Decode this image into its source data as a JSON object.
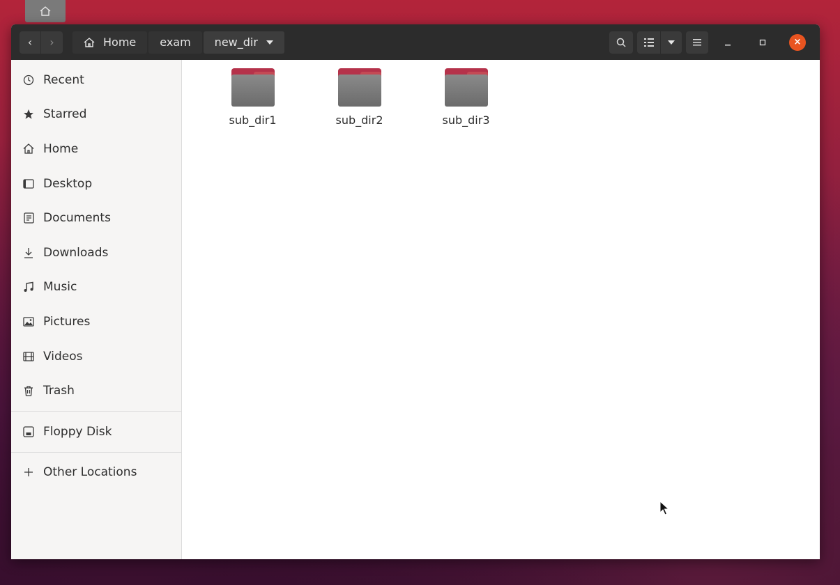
{
  "window": {
    "nav": {
      "back": "‹",
      "forward": "›"
    },
    "path": [
      {
        "label": "Home",
        "icon": "home-icon"
      },
      {
        "label": "exam"
      },
      {
        "label": "new_dir",
        "current": true
      }
    ],
    "toolbar": {
      "search": "search-icon",
      "view": "list-view-icon",
      "menu": "hamburger-menu-icon"
    },
    "controls": {
      "minimize": "–",
      "maximize": "▫",
      "close": "×"
    }
  },
  "sidebar": {
    "items": [
      {
        "label": "Recent",
        "icon": "clock-icon"
      },
      {
        "label": "Starred",
        "icon": "star-icon"
      },
      {
        "label": "Home",
        "icon": "home-icon"
      },
      {
        "label": "Desktop",
        "icon": "desktop-icon"
      },
      {
        "label": "Documents",
        "icon": "documents-icon"
      },
      {
        "label": "Downloads",
        "icon": "download-icon"
      },
      {
        "label": "Music",
        "icon": "music-icon"
      },
      {
        "label": "Pictures",
        "icon": "pictures-icon"
      },
      {
        "label": "Videos",
        "icon": "videos-icon"
      },
      {
        "label": "Trash",
        "icon": "trash-icon"
      }
    ],
    "devices": [
      {
        "label": "Floppy Disk",
        "icon": "floppy-disk-icon"
      }
    ],
    "other": {
      "label": "Other Locations",
      "icon": "plus-icon"
    }
  },
  "files": [
    {
      "name": "sub_dir1"
    },
    {
      "name": "sub_dir2"
    },
    {
      "name": "sub_dir3"
    }
  ],
  "colors": {
    "accent": "#e95420",
    "folder_tab": "#b5324a"
  }
}
